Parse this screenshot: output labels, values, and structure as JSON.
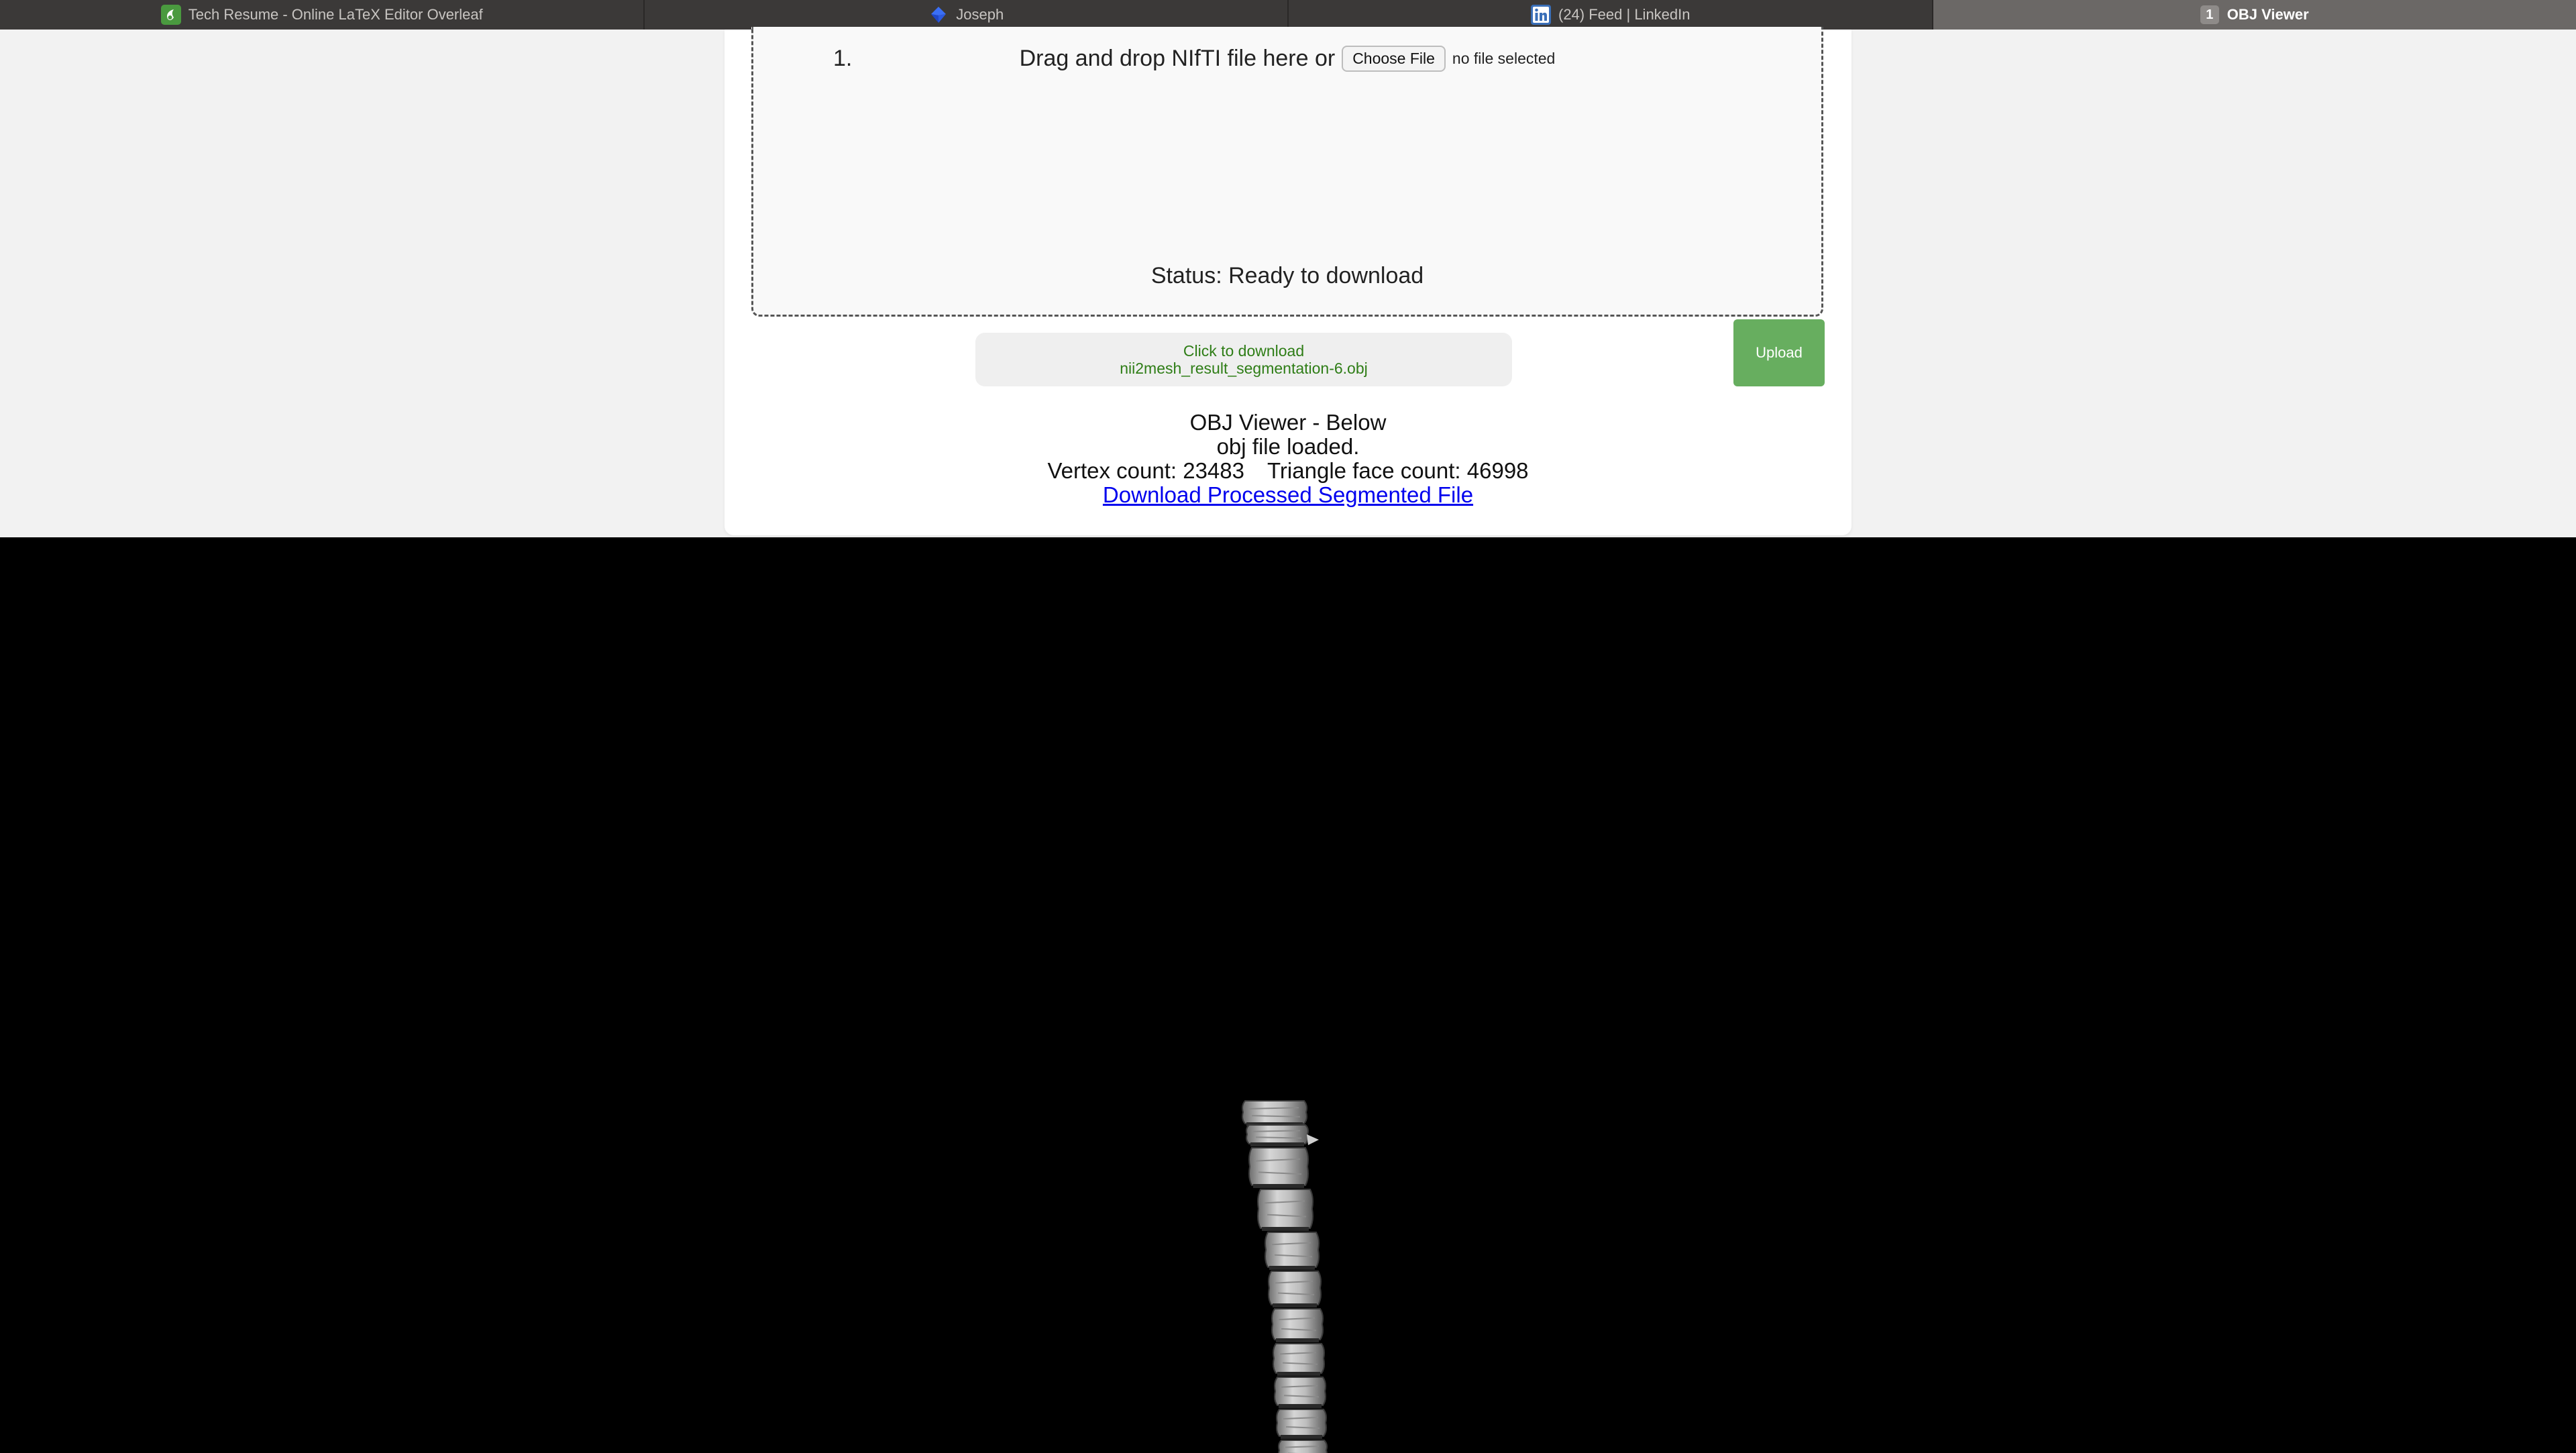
{
  "tabs": [
    {
      "label": "Tech Resume - Online LaTeX Editor Overleaf",
      "icon": "overleaf-icon",
      "active": false
    },
    {
      "label": "Joseph",
      "icon": "blue-diamond-icon",
      "active": false
    },
    {
      "label": "(24) Feed | LinkedIn",
      "icon": "linkedin-icon",
      "active": false
    },
    {
      "label": "OBJ Viewer",
      "badge": "1",
      "active": true
    }
  ],
  "upload": {
    "step": "1.",
    "drag_text": "Drag and drop NIfTI file here or",
    "choose_label": "Choose File",
    "no_file": "no file selected",
    "status": "Status: Ready to download",
    "upload_label": "Upload"
  },
  "download": {
    "line1": "Click to download",
    "line2": "nii2mesh_result_segmentation-6.obj"
  },
  "viewer_info": {
    "title": "OBJ Viewer - Below",
    "loaded": "obj file loaded.",
    "vertex": "Vertex count: 23483",
    "faces": "Triangle face count: 46998",
    "link": "Download Processed Segmented File"
  },
  "colors": {
    "tabbar": "#3b3938",
    "active_tab": "#6b6866",
    "upload_green": "#67ae5f",
    "download_text": "#2e7d16",
    "link": "#0000ee",
    "viewer_bg": "#000000"
  }
}
